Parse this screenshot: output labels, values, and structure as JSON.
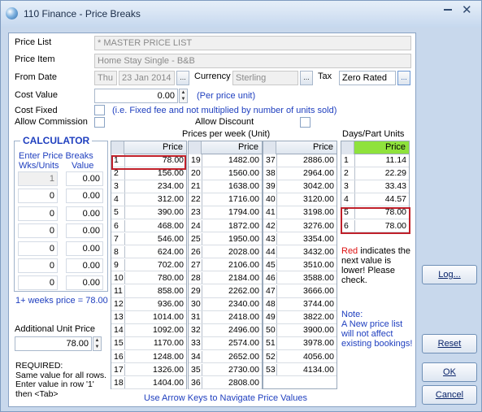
{
  "window": {
    "title": "110 Finance - Price Breaks"
  },
  "form": {
    "price_list_label": "Price List",
    "price_list_value": "* MASTER PRICE LIST",
    "price_item_label": "Price Item",
    "price_item_value": "Home Stay Single - B&B",
    "from_date_label": "From Date",
    "from_date_day": "Thu",
    "from_date_value": "23 Jan 2014",
    "currency_label": "Currency",
    "currency_value": "Sterling",
    "tax_label": "Tax",
    "tax_value": "Zero Rated",
    "cost_value_label": "Cost Value",
    "cost_value": "0.00",
    "per_price_unit": "(Per price unit)",
    "cost_fixed_label": "Cost Fixed",
    "cost_fixed_note": "(i.e. Fixed fee and not multiplied by number of units sold)",
    "allow_commission_label": "Allow Commission",
    "allow_discount_label": "Allow Discount",
    "dots": "..."
  },
  "calculator": {
    "title": "CALCULATOR",
    "enter_label": "Enter Price Breaks",
    "wks_units_label": "Wks/Units",
    "value_label": "Value",
    "rows": [
      {
        "n": "1",
        "v": "0.00"
      },
      {
        "n": "0",
        "v": "0.00"
      },
      {
        "n": "0",
        "v": "0.00"
      },
      {
        "n": "0",
        "v": "0.00"
      },
      {
        "n": "0",
        "v": "0.00"
      },
      {
        "n": "0",
        "v": "0.00"
      },
      {
        "n": "0",
        "v": "0.00"
      }
    ],
    "summary": "1+ weeks price = 78.00",
    "additional_label": "Additional Unit Price",
    "additional_value": "78.00",
    "required_text": "REQUIRED:\nSame value for all rows.  Enter value in row '1' then <Tab>"
  },
  "prices_week": {
    "title": "Prices per week (Unit)",
    "col_header": "Price",
    "col1": [
      [
        "1",
        "78.00"
      ],
      [
        "2",
        "156.00"
      ],
      [
        "3",
        "234.00"
      ],
      [
        "4",
        "312.00"
      ],
      [
        "5",
        "390.00"
      ],
      [
        "6",
        "468.00"
      ],
      [
        "7",
        "546.00"
      ],
      [
        "8",
        "624.00"
      ],
      [
        "9",
        "702.00"
      ],
      [
        "10",
        "780.00"
      ],
      [
        "11",
        "858.00"
      ],
      [
        "12",
        "936.00"
      ],
      [
        "13",
        "1014.00"
      ],
      [
        "14",
        "1092.00"
      ],
      [
        "15",
        "1170.00"
      ],
      [
        "16",
        "1248.00"
      ],
      [
        "17",
        "1326.00"
      ],
      [
        "18",
        "1404.00"
      ]
    ],
    "col2": [
      [
        "19",
        "1482.00"
      ],
      [
        "20",
        "1560.00"
      ],
      [
        "21",
        "1638.00"
      ],
      [
        "22",
        "1716.00"
      ],
      [
        "23",
        "1794.00"
      ],
      [
        "24",
        "1872.00"
      ],
      [
        "25",
        "1950.00"
      ],
      [
        "26",
        "2028.00"
      ],
      [
        "27",
        "2106.00"
      ],
      [
        "28",
        "2184.00"
      ],
      [
        "29",
        "2262.00"
      ],
      [
        "30",
        "2340.00"
      ],
      [
        "31",
        "2418.00"
      ],
      [
        "32",
        "2496.00"
      ],
      [
        "33",
        "2574.00"
      ],
      [
        "34",
        "2652.00"
      ],
      [
        "35",
        "2730.00"
      ],
      [
        "36",
        "2808.00"
      ]
    ],
    "col3": [
      [
        "37",
        "2886.00"
      ],
      [
        "38",
        "2964.00"
      ],
      [
        "39",
        "3042.00"
      ],
      [
        "40",
        "3120.00"
      ],
      [
        "41",
        "3198.00"
      ],
      [
        "42",
        "3276.00"
      ],
      [
        "43",
        "3354.00"
      ],
      [
        "44",
        "3432.00"
      ],
      [
        "45",
        "3510.00"
      ],
      [
        "46",
        "3588.00"
      ],
      [
        "47",
        "3666.00"
      ],
      [
        "48",
        "3744.00"
      ],
      [
        "49",
        "3822.00"
      ],
      [
        "50",
        "3900.00"
      ],
      [
        "51",
        "3978.00"
      ],
      [
        "52",
        "4056.00"
      ],
      [
        "53",
        "4134.00"
      ]
    ],
    "footer": "Use Arrow Keys to Navigate Price Values"
  },
  "days": {
    "title": "Days/Part Units",
    "col_header": "Price",
    "rows": [
      [
        "1",
        "11.14"
      ],
      [
        "2",
        "22.29"
      ],
      [
        "3",
        "33.43"
      ],
      [
        "4",
        "44.57"
      ],
      [
        "5",
        "78.00"
      ],
      [
        "6",
        "78.00"
      ]
    ]
  },
  "notes": {
    "red_word": "Red",
    "red_text": " indicates the next value is lower!  Please check.",
    "note_label": "Note:",
    "note_text": "A New price list will not affect existing bookings!"
  },
  "buttons": {
    "log": "Log...",
    "reset": "Reset",
    "ok": "OK",
    "cancel": "Cancel"
  },
  "colors": {
    "highlight_red": "#c0202a",
    "label_blue": "#1f3fbf",
    "days_header_green": "#8fe23c"
  }
}
